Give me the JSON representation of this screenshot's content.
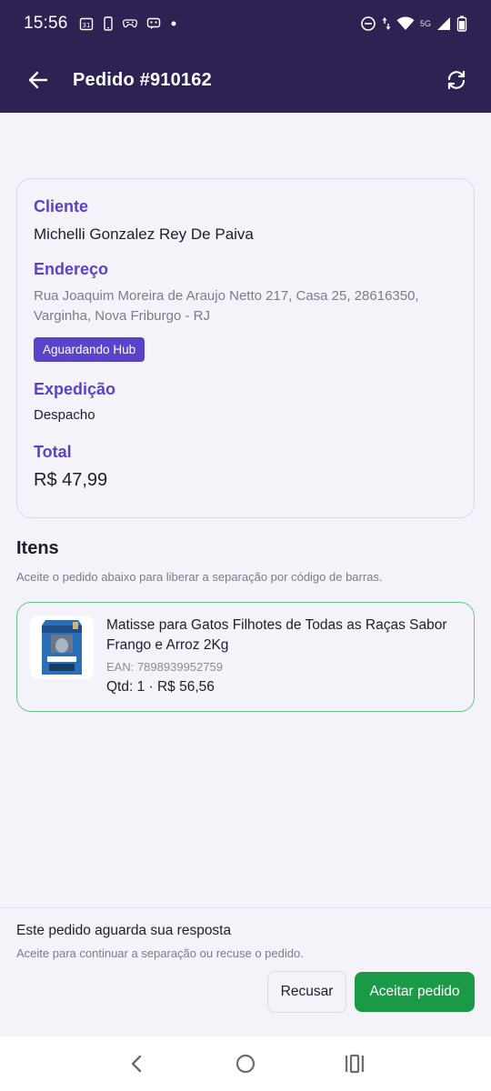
{
  "status_bar": {
    "time": "15:56",
    "network_label": "5G",
    "icons": [
      "calendar-icon",
      "phone-icon",
      "gamepad-icon",
      "message-icon",
      "dot-icon",
      "do-not-disturb-icon",
      "data-arrows-icon",
      "wifi-icon",
      "signal-icon",
      "battery-icon"
    ]
  },
  "app_bar": {
    "title": "Pedido #910162",
    "background": "#2d2252"
  },
  "order": {
    "client_label": "Cliente",
    "client_name": "Michelli Gonzalez Rey De Paiva",
    "address_label": "Endereço",
    "address": "Rua Joaquim Moreira de Araujo Netto 217, Casa 25, 28616350, Varginha, Nova Friburgo - RJ",
    "status_badge": "Aguardando Hub",
    "shipping_label": "Expedição",
    "shipping_value": "Despacho",
    "total_label": "Total",
    "total_value": "R$ 47,99"
  },
  "items_section": {
    "title": "Itens",
    "hint": "Aceite o pedido abaixo para liberar a separação por código de barras.",
    "items": [
      {
        "name": "Matisse para Gatos Filhotes de Todas as Raças Sabor Frango e Arroz 2Kg",
        "ean": "EAN: 7898939952759",
        "qty_price": "Qtd: 1 · R$ 56,56"
      }
    ]
  },
  "bottom_panel": {
    "title": "Este pedido aguarda sua resposta",
    "subtitle": "Aceite para continuar a separação ou recuse o pedido.",
    "refuse_label": "Recusar",
    "accept_label": "Aceitar pedido"
  },
  "colors": {
    "accent": "#5a42c9",
    "accept": "#1a9a47",
    "item_border": "#68c78c"
  }
}
